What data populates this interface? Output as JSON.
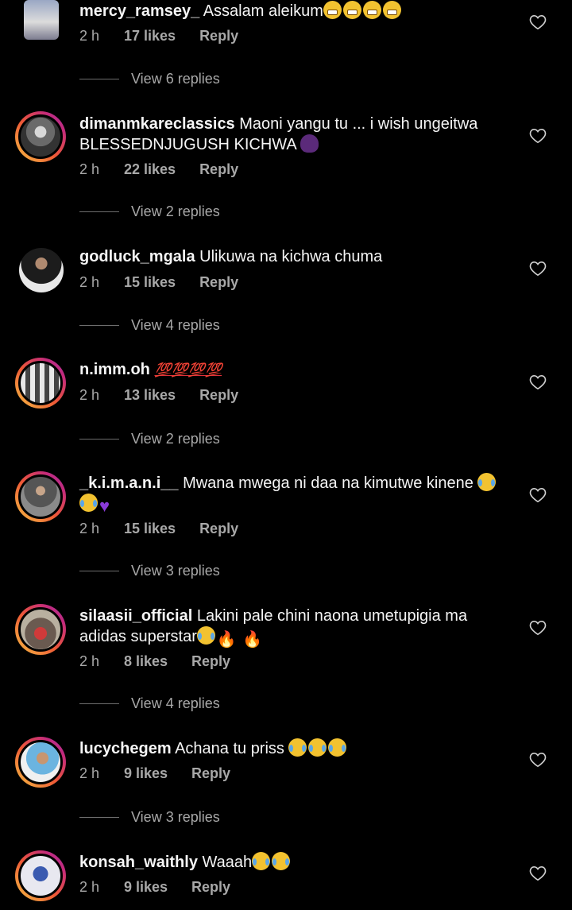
{
  "comments": [
    {
      "user": "mercy_ramsey_",
      "text": "Assalam aleikum",
      "emojis": "😁😁😁😁",
      "time": "2 h",
      "likes": "17 likes",
      "reply": "Reply",
      "view_replies": "View 6 replies"
    },
    {
      "user": "dimanmkareclassics",
      "text": "Maoni yangu tu ... i wish ungeitwa BLESSEDNJUGUSH KICHWA",
      "emojis": "🙆🏿‍♀️",
      "time": "2 h",
      "likes": "22 likes",
      "reply": "Reply",
      "view_replies": "View 2 replies"
    },
    {
      "user": "godluck_mgala",
      "text": "Ulikuwa na kichwa chuma",
      "emojis": "",
      "time": "2 h",
      "likes": "15 likes",
      "reply": "Reply",
      "view_replies": "View 4 replies"
    },
    {
      "user": "n.imm.oh",
      "text": "",
      "emojis": "💯💯💯💯",
      "time": "2 h",
      "likes": "13 likes",
      "reply": "Reply",
      "view_replies": "View 2 replies"
    },
    {
      "user": "_k.i.m.a.n.i__",
      "text": "Mwana mwega ni daa na kimutwe kinene",
      "emojis": "😂😂💜",
      "time": "2 h",
      "likes": "15 likes",
      "reply": "Reply",
      "view_replies": "View 3 replies"
    },
    {
      "user": "silaasii_official",
      "text": "Lakini pale chini naona umetupigia ma adidas superstar",
      "emojis": "😂🔥🔥",
      "time": "2 h",
      "likes": "8 likes",
      "reply": "Reply",
      "view_replies": "View 4 replies"
    },
    {
      "user": "lucychegem",
      "text": "Achana tu priss",
      "emojis": "😂😂😂",
      "time": "2 h",
      "likes": "9 likes",
      "reply": "Reply",
      "view_replies": "View 3 replies"
    },
    {
      "user": "konsah_waithly",
      "text": "Waaah",
      "emojis": "😂😂",
      "time": "2 h",
      "likes": "9 likes",
      "reply": "Reply"
    }
  ],
  "icons": {
    "like": "heart-outline-icon"
  },
  "colors": {
    "background": "#000000",
    "text": "#f5f5f5",
    "muted": "#a8a8a8"
  }
}
